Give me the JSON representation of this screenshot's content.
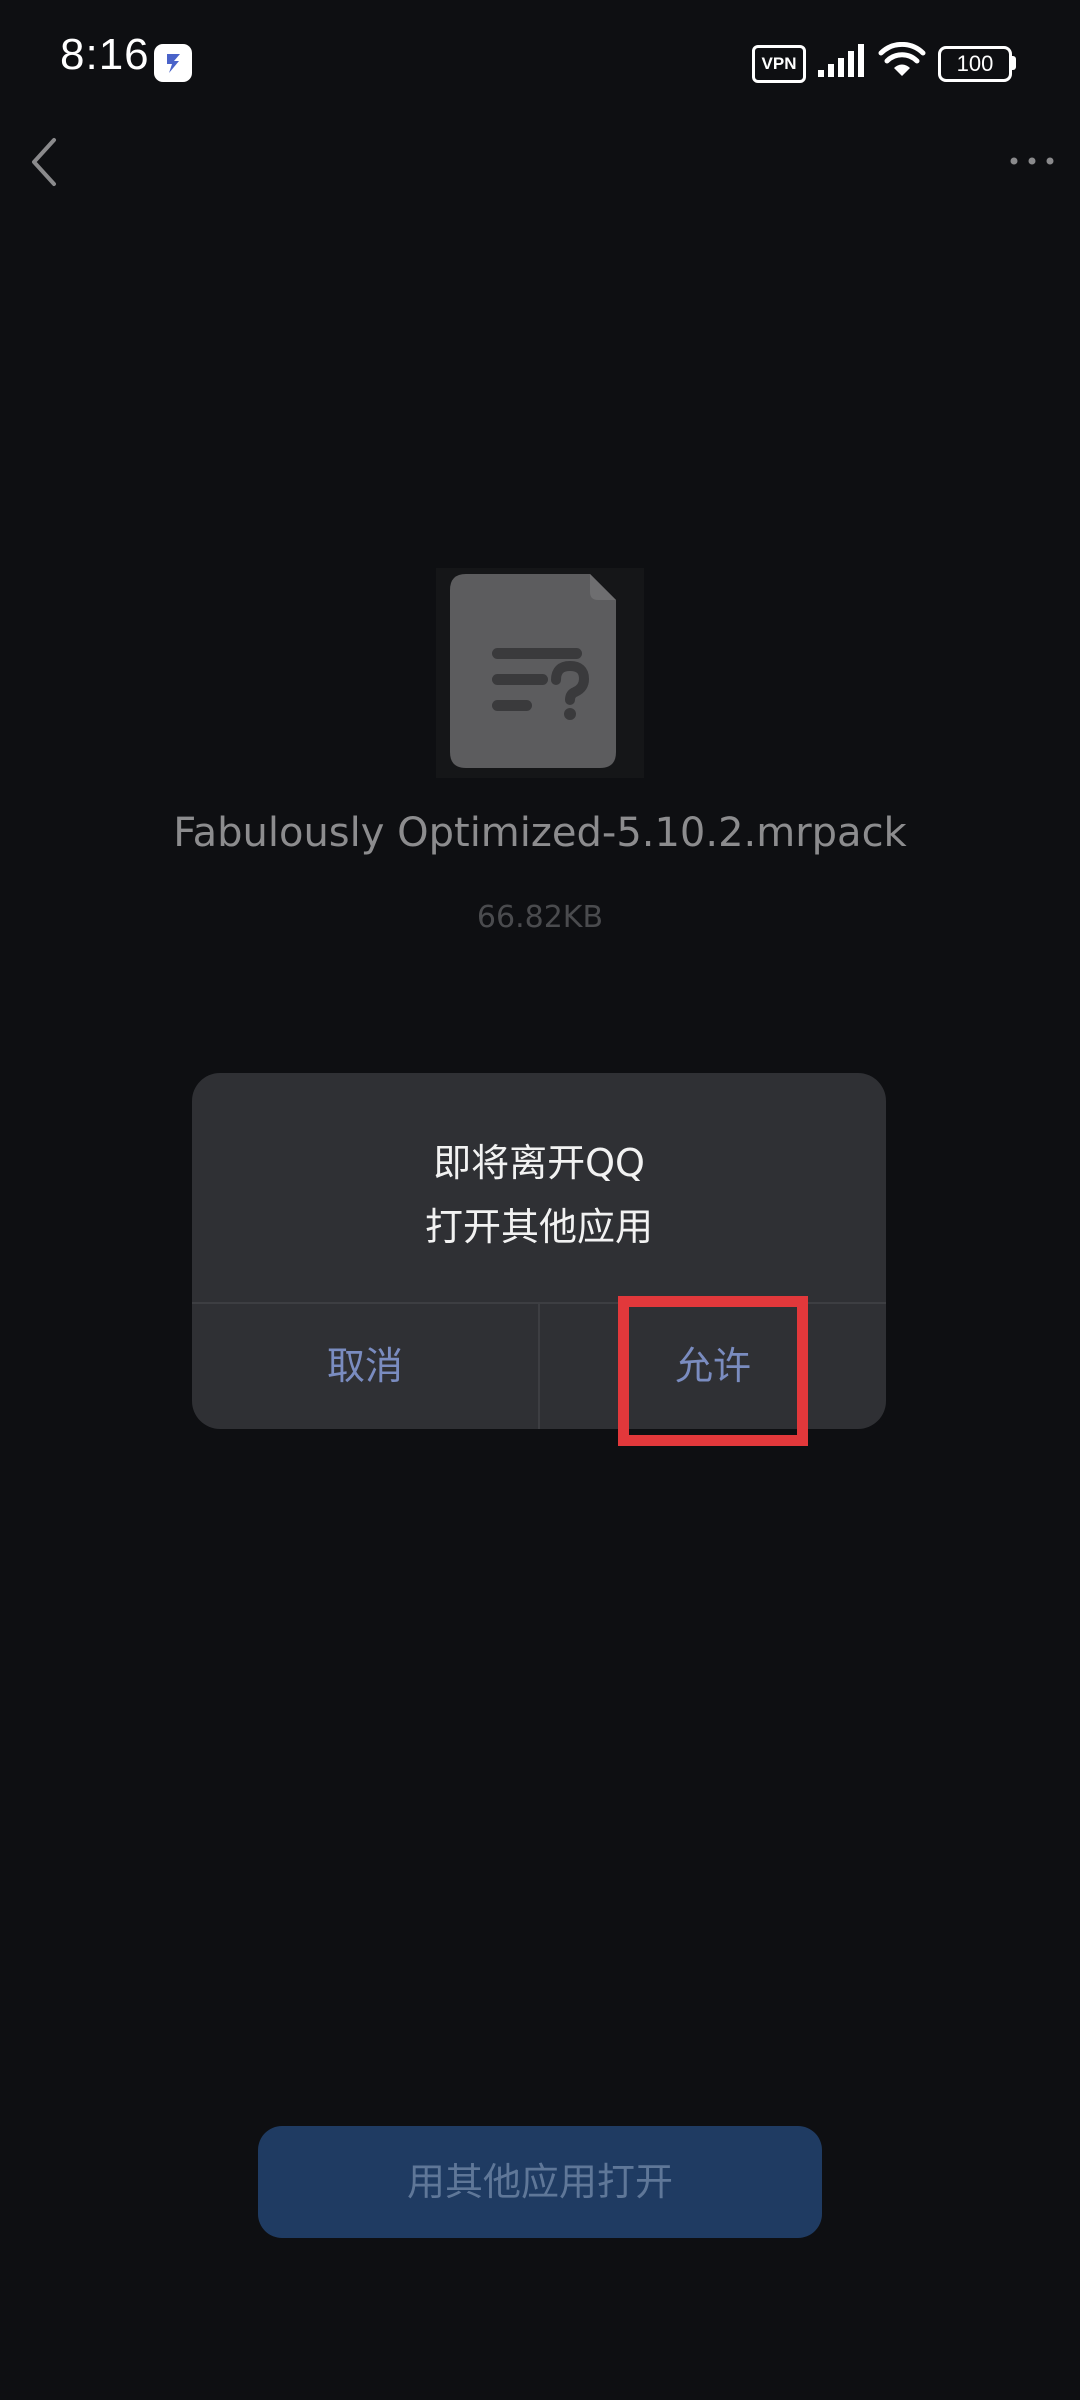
{
  "status_bar": {
    "time": "8:16",
    "vpn_label": "VPN",
    "battery_level": "100",
    "icons": [
      "app-notification-icon",
      "vpn-icon",
      "signal-icon",
      "wifi-icon",
      "battery-icon"
    ]
  },
  "nav": {
    "back_icon": "chevron-left-icon",
    "more_icon": "more-dots-icon"
  },
  "file": {
    "icon": "unknown-file-icon",
    "name": "Fabulously Optimized-5.10.2.mrpack",
    "size": "66.82KB"
  },
  "dialog": {
    "line1": "即将离开QQ",
    "line2": "打开其他应用",
    "cancel_label": "取消",
    "allow_label": "允许"
  },
  "bottom": {
    "open_with_label": "用其他应用打开"
  },
  "colors": {
    "background": "#0e0f12",
    "dialog_bg": "#2f3034",
    "dialog_button_text": "#7a8cc0",
    "highlight": "#e2383b",
    "primary_button_bg": "#1f3b62"
  }
}
